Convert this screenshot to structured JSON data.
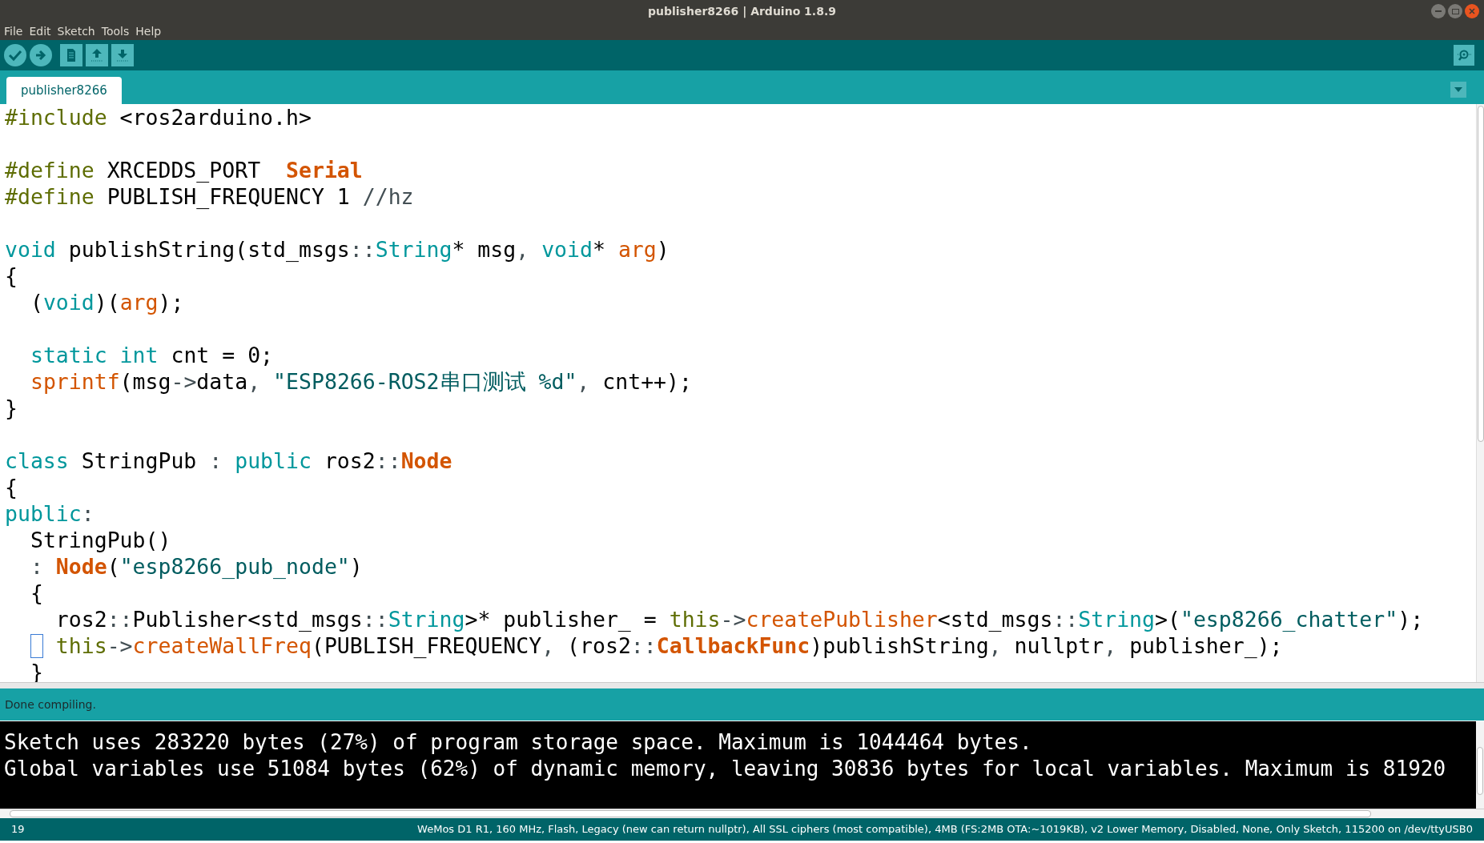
{
  "window": {
    "title": "publisher8266 | Arduino 1.8.9"
  },
  "menu": [
    "File",
    "Edit",
    "Sketch",
    "Tools",
    "Help"
  ],
  "toolbar": [
    {
      "kind": "verify"
    },
    {
      "kind": "upload"
    },
    {
      "kind": "new"
    },
    {
      "kind": "open"
    },
    {
      "kind": "save"
    }
  ],
  "tabs": [
    {
      "label": "publisher8266",
      "selected": true
    }
  ],
  "editor": {
    "lines": [
      {
        "kind": "code",
        "tokens": [
          {
            "kind": "pre",
            "text": "#include"
          },
          {
            "kind": "plain",
            "text": " <ros2arduino.h>"
          }
        ]
      },
      {
        "kind": "blank"
      },
      {
        "kind": "code",
        "tokens": [
          {
            "kind": "pre",
            "text": "#define"
          },
          {
            "kind": "plain",
            "text": " XRCEDDS_PORT  "
          },
          {
            "kind": "bold",
            "text": "Serial"
          }
        ]
      },
      {
        "kind": "code",
        "tokens": [
          {
            "kind": "pre",
            "text": "#define"
          },
          {
            "kind": "plain",
            "text": " PUBLISH_FREQUENCY 1 "
          },
          {
            "kind": "comment",
            "text": "//hz"
          }
        ]
      },
      {
        "kind": "blank"
      },
      {
        "kind": "code",
        "tokens": [
          {
            "kind": "kw",
            "text": "void"
          },
          {
            "kind": "plain",
            "text": " publishString(std_msgs"
          },
          {
            "kind": "punct",
            "text": "::"
          },
          {
            "kind": "kw",
            "text": "String"
          },
          {
            "kind": "plain",
            "text": "* msg"
          },
          {
            "kind": "punct",
            "text": ","
          },
          {
            "kind": "kw",
            "text": " void"
          },
          {
            "kind": "plain",
            "text": "* "
          },
          {
            "kind": "fn",
            "text": "arg"
          },
          {
            "kind": "plain",
            "text": ")"
          }
        ]
      },
      {
        "kind": "code",
        "tokens": [
          {
            "kind": "plain",
            "text": "{"
          }
        ]
      },
      {
        "kind": "code",
        "tokens": [
          {
            "kind": "plain",
            "text": "  ("
          },
          {
            "kind": "kw",
            "text": "void"
          },
          {
            "kind": "plain",
            "text": ")("
          },
          {
            "kind": "fn",
            "text": "arg"
          },
          {
            "kind": "plain",
            "text": ");"
          }
        ]
      },
      {
        "kind": "blank"
      },
      {
        "kind": "code",
        "tokens": [
          {
            "kind": "kw",
            "text": "  static"
          },
          {
            "kind": "kw",
            "text": " int"
          },
          {
            "kind": "plain",
            "text": " cnt = 0;"
          }
        ]
      },
      {
        "kind": "code",
        "tokens": [
          {
            "kind": "fn",
            "text": "  sprintf"
          },
          {
            "kind": "plain",
            "text": "(msg"
          },
          {
            "kind": "punct",
            "text": "->"
          },
          {
            "kind": "plain",
            "text": "data"
          },
          {
            "kind": "punct",
            "text": ","
          },
          {
            "kind": "str",
            "text": " \"ESP8266-ROS2串口测试 %d\""
          },
          {
            "kind": "punct",
            "text": ","
          },
          {
            "kind": "plain",
            "text": " cnt++);"
          }
        ]
      },
      {
        "kind": "code",
        "tokens": [
          {
            "kind": "plain",
            "text": "}"
          }
        ]
      },
      {
        "kind": "blank"
      },
      {
        "kind": "code",
        "tokens": [
          {
            "kind": "kw",
            "text": "class"
          },
          {
            "kind": "plain",
            "text": " StringPub "
          },
          {
            "kind": "punct",
            "text": ":"
          },
          {
            "kind": "kw",
            "text": " public"
          },
          {
            "kind": "plain",
            "text": " ros2"
          },
          {
            "kind": "punct",
            "text": "::"
          },
          {
            "kind": "bold",
            "text": "Node"
          }
        ]
      },
      {
        "kind": "code",
        "tokens": [
          {
            "kind": "plain",
            "text": "{"
          }
        ]
      },
      {
        "kind": "code",
        "tokens": [
          {
            "kind": "kw",
            "text": "public"
          },
          {
            "kind": "punct",
            "text": ":"
          }
        ]
      },
      {
        "kind": "code",
        "tokens": [
          {
            "kind": "plain",
            "text": "  StringPub()"
          }
        ]
      },
      {
        "kind": "code",
        "tokens": [
          {
            "kind": "punct",
            "text": "  :"
          },
          {
            "kind": "bold",
            "text": " Node"
          },
          {
            "kind": "plain",
            "text": "("
          },
          {
            "kind": "str",
            "text": "\"esp8266_pub_node\""
          },
          {
            "kind": "plain",
            "text": ")"
          }
        ]
      },
      {
        "kind": "code",
        "tokens": [
          {
            "kind": "plain",
            "text": "  {"
          }
        ]
      },
      {
        "kind": "code",
        "tokens": [
          {
            "kind": "plain",
            "text": "    ros2"
          },
          {
            "kind": "punct",
            "text": "::"
          },
          {
            "kind": "plain",
            "text": "Publisher<std_msgs"
          },
          {
            "kind": "punct",
            "text": "::"
          },
          {
            "kind": "kw",
            "text": "String"
          },
          {
            "kind": "plain",
            "text": ">* publisher_ = "
          },
          {
            "kind": "pre",
            "text": "this"
          },
          {
            "kind": "punct",
            "text": "->"
          },
          {
            "kind": "fn",
            "text": "createPublisher"
          },
          {
            "kind": "plain",
            "text": "<std_msgs"
          },
          {
            "kind": "punct",
            "text": "::"
          },
          {
            "kind": "kw",
            "text": "String"
          },
          {
            "kind": "plain",
            "text": ">("
          },
          {
            "kind": "str",
            "text": "\"esp8266_chatter\""
          },
          {
            "kind": "plain",
            "text": ");"
          }
        ]
      },
      {
        "kind": "code",
        "caret": true,
        "tokens": [
          {
            "kind": "pre",
            "text": "    this"
          },
          {
            "kind": "punct",
            "text": "->"
          },
          {
            "kind": "fn",
            "text": "createWallFreq"
          },
          {
            "kind": "plain",
            "text": "(PUBLISH_FREQUENCY"
          },
          {
            "kind": "punct",
            "text": ","
          },
          {
            "kind": "plain",
            "text": " (ros2"
          },
          {
            "kind": "punct",
            "text": "::"
          },
          {
            "kind": "bold",
            "text": "CallbackFunc"
          },
          {
            "kind": "plain",
            "text": ")publishString"
          },
          {
            "kind": "punct",
            "text": ","
          },
          {
            "kind": "plain",
            "text": " nullptr"
          },
          {
            "kind": "punct",
            "text": ","
          },
          {
            "kind": "plain",
            "text": " publisher_);"
          }
        ]
      },
      {
        "kind": "code",
        "tokens": [
          {
            "kind": "plain",
            "text": "  }"
          }
        ]
      }
    ]
  },
  "message": "Done compiling.",
  "console": [
    "Sketch uses 283220 bytes (27%) of program storage space. Maximum is 1044464 bytes.",
    "Global variables use 51084 bytes (62%) of dynamic memory, leaving 30836 bytes for local variables. Maximum is 81920"
  ],
  "status_bar": {
    "line": "19",
    "board": "WeMos D1 R1, 160 MHz, Flash, Legacy (new can return nullptr), All SSL ciphers (most compatible), 4MB (FS:2MB OTA:~1019KB), v2 Lower Memory, Disabled, None, Only Sketch, 115200 on /dev/ttyUSB0"
  }
}
